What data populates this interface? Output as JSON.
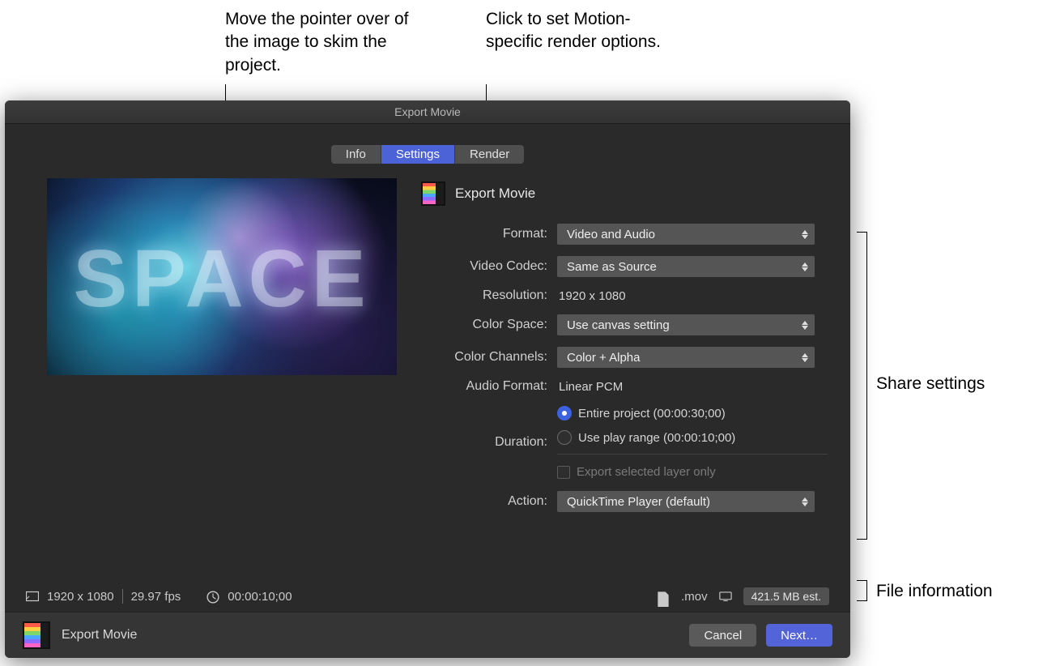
{
  "callouts": {
    "preview": "Move the pointer over of the image to skim the project.",
    "render": "Click to set Motion-specific render options.",
    "share": "Share settings",
    "fileinfo": "File information"
  },
  "window": {
    "title": "Export Movie"
  },
  "tabs": {
    "info": "Info",
    "settings": "Settings",
    "render": "Render"
  },
  "preview": {
    "word": "SPACE"
  },
  "header": {
    "title": "Export Movie"
  },
  "labels": {
    "format": "Format:",
    "videoCodec": "Video Codec:",
    "resolution": "Resolution:",
    "colorSpace": "Color Space:",
    "colorChannels": "Color Channels:",
    "audioFormat": "Audio Format:",
    "duration": "Duration:",
    "action": "Action:"
  },
  "values": {
    "format": "Video and Audio",
    "videoCodec": "Same as Source",
    "resolution": "1920 x 1080",
    "colorSpace": "Use canvas setting",
    "colorChannels": "Color + Alpha",
    "audioFormat": "Linear PCM",
    "durationEntire": "Entire project (00:00:30;00)",
    "durationRange": "Use play range (00:00:10;00)",
    "exportSelected": "Export selected layer only",
    "action": "QuickTime Player (default)"
  },
  "status": {
    "dims": "1920 x 1080",
    "fps": "29.97 fps",
    "time": "00:00:10;00",
    "ext": ".mov",
    "size": "421.5 MB est."
  },
  "footer": {
    "title": "Export Movie",
    "cancel": "Cancel",
    "next": "Next…"
  }
}
